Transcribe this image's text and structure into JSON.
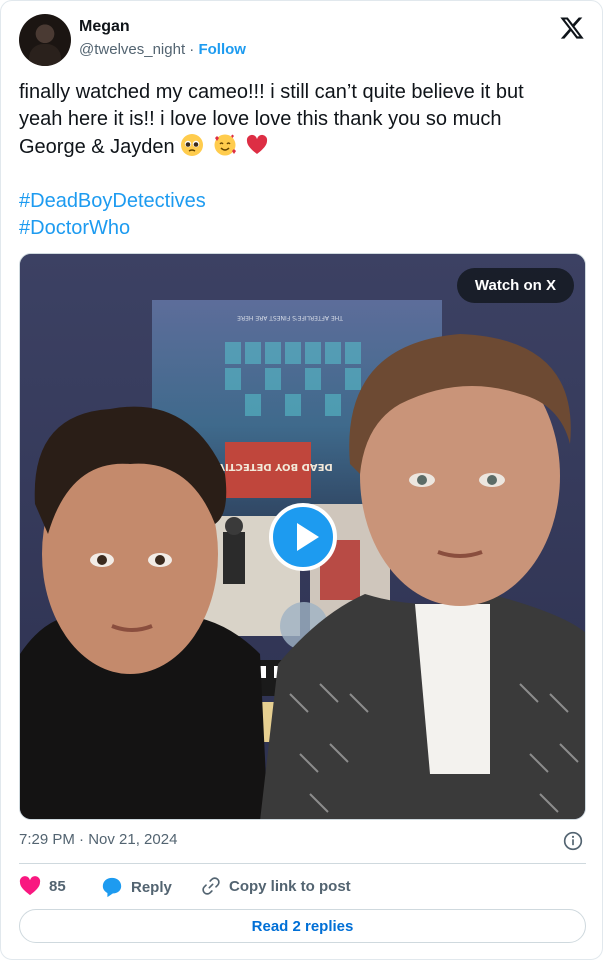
{
  "author": {
    "name": "Megan",
    "handle": "@twelves_night",
    "separator": "·",
    "follow_label": "Follow"
  },
  "tweet": {
    "line1": "finally watched my cameo!!! i still can’t quite believe it but",
    "line2": "yeah here it is!! i love love love this thank you so much",
    "line3": "George & Jayden",
    "emojis": [
      "pleading-face",
      "smiling-face-with-hearts",
      "red-heart"
    ],
    "hashtags": [
      "#DeadBoyDetectives",
      "#DoctorWho"
    ]
  },
  "media": {
    "watch_label": "Watch on X",
    "poster_text_top": "THE AFTERLIFE'S FINEST ARE HERE",
    "poster_logo": "DEAD BOY DETECTIVES"
  },
  "meta": {
    "timestamp": "7:29 PM · Nov 21, 2024"
  },
  "actions": {
    "likes_count": "85",
    "reply_label": "Reply",
    "copy_link_label": "Copy link to post"
  },
  "read_replies_label": "Read 2 replies",
  "colors": {
    "accent": "#1d9bf0",
    "like": "#f91880",
    "link_dark": "#006fd6",
    "secondary_text": "#536471"
  }
}
